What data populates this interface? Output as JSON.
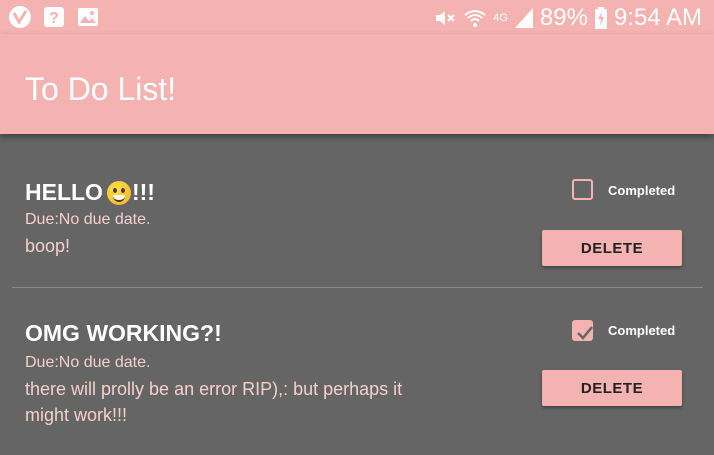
{
  "status_bar": {
    "battery": "89%",
    "time": "9:54 AM",
    "network": "4G",
    "icons": [
      "v-app-icon",
      "help-box-icon",
      "image-icon",
      "mute-icon",
      "wifi-icon",
      "signal-icon",
      "battery-charging-icon"
    ]
  },
  "app_bar": {
    "title": "To Do List!"
  },
  "items": [
    {
      "title_before": "HELLO",
      "title_emoji": "grinning-emoji",
      "title_after": "!!!",
      "due": "Due:No due date.",
      "description": "boop!",
      "completed": false,
      "completed_label": "Completed",
      "delete_label": "DELETE"
    },
    {
      "title": "OMG WORKING?!",
      "due": "Due:No due date.",
      "description": "there will prolly be an error RIP),: but perhaps it might work!!!",
      "completed": true,
      "completed_label": "Completed",
      "delete_label": "DELETE"
    }
  ],
  "colors": {
    "accent": "#f4b3b1",
    "background": "#656565",
    "text_secondary": "#f4cfcf"
  }
}
